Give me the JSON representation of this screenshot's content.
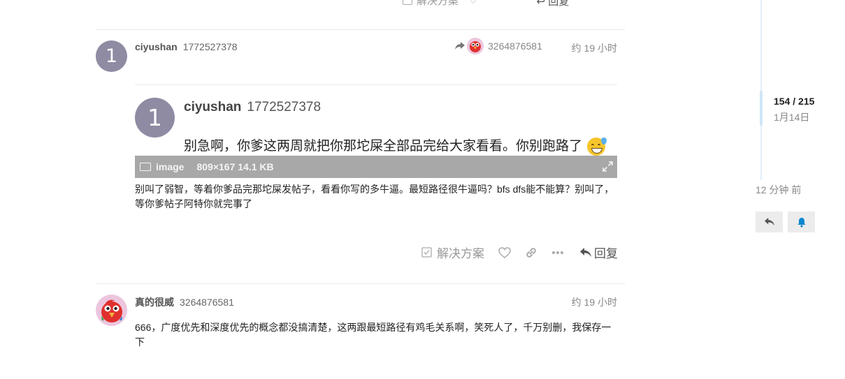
{
  "previous_post_actions": {
    "solution_label": "解决方案",
    "reply_label": "回复"
  },
  "post1": {
    "avatar_letter": "1",
    "username": "ciyushan",
    "user_id": "1772527378",
    "reply_to_user_id": "3264876581",
    "time": "约 19 小时",
    "quote": {
      "avatar_letter": "1",
      "username": "ciyushan",
      "user_id": "1772527378",
      "text": "别急啊，你爹这两周就把你那坨屎全部品完给大家看看。你别跑路了"
    },
    "image": {
      "label": "image",
      "meta": "809×167 14.1 KB"
    },
    "body": "别叫了弱智，等着你爹品完那坨屎发帖子，看看你写的多牛逼。最短路径很牛逼吗？bfs dfs能不能算？别叫了，等你爹帖子阿特你就完事了",
    "actions": {
      "solution_label": "解决方案",
      "reply_label": "回复"
    }
  },
  "post2": {
    "username": "真的很威",
    "user_id": "3264876581",
    "time": "约 19 小时",
    "body": "666，广度优先和深度优先的概念都没搞清楚，这两跟最短路径有鸡毛关系啊，笑死人了，千万别删，我保存一下"
  },
  "timeline": {
    "count": "154 / 215",
    "date": "1月14日",
    "ago": "12 分钟 前"
  },
  "colors": {
    "avatar_letter_bg": "#8f8ba3",
    "image_bar_bg": "#a8a8a8",
    "notify_blue": "#0b87d0"
  }
}
